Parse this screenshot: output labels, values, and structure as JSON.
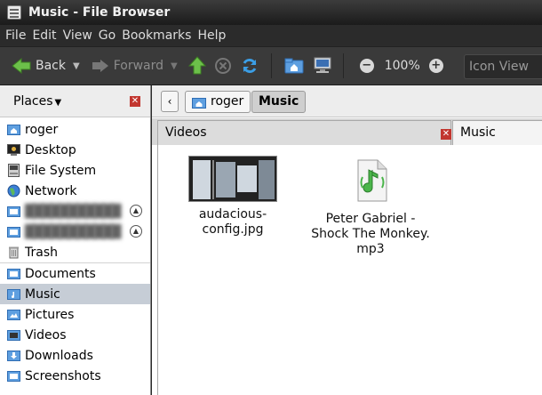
{
  "window": {
    "title": "Music - File Browser"
  },
  "menu": [
    "File",
    "Edit",
    "View",
    "Go",
    "Bookmarks",
    "Help"
  ],
  "toolbar": {
    "back": "Back",
    "forward": "Forward",
    "zoom": "100%",
    "view_mode": "Icon View"
  },
  "sidebar": {
    "header": "Places",
    "items": [
      {
        "label": "roger",
        "icon": "home-folder-icon"
      },
      {
        "label": "Desktop",
        "icon": "desktop-icon"
      },
      {
        "label": "File System",
        "icon": "drive-icon"
      },
      {
        "label": "Network",
        "icon": "network-icon"
      },
      {
        "label": "",
        "icon": "drive-icon"
      },
      {
        "label": "",
        "icon": "drive-icon"
      },
      {
        "label": "Trash",
        "icon": "trash-icon"
      },
      {
        "label": "Documents",
        "icon": "folder-icon"
      },
      {
        "label": "Music",
        "icon": "music-folder-icon",
        "selected": true
      },
      {
        "label": "Pictures",
        "icon": "pictures-folder-icon"
      },
      {
        "label": "Videos",
        "icon": "videos-folder-icon"
      },
      {
        "label": "Downloads",
        "icon": "downloads-folder-icon"
      },
      {
        "label": "Screenshots",
        "icon": "folder-icon"
      }
    ]
  },
  "path": {
    "segments": [
      "roger",
      "Music"
    ]
  },
  "tabs": [
    {
      "label": "Videos"
    },
    {
      "label": "Music"
    }
  ],
  "files": [
    {
      "name": "audacious-config.jpg",
      "icon": "image-thumbnail-icon"
    },
    {
      "name_lines": [
        "Peter Gabriel -",
        "Shock The Monkey.",
        "mp3"
      ],
      "icon": "audio-file-icon"
    }
  ],
  "colors": {
    "accent": "#3b7fd6",
    "close": "#c2362f",
    "selected_row": "#c6cdd6"
  }
}
